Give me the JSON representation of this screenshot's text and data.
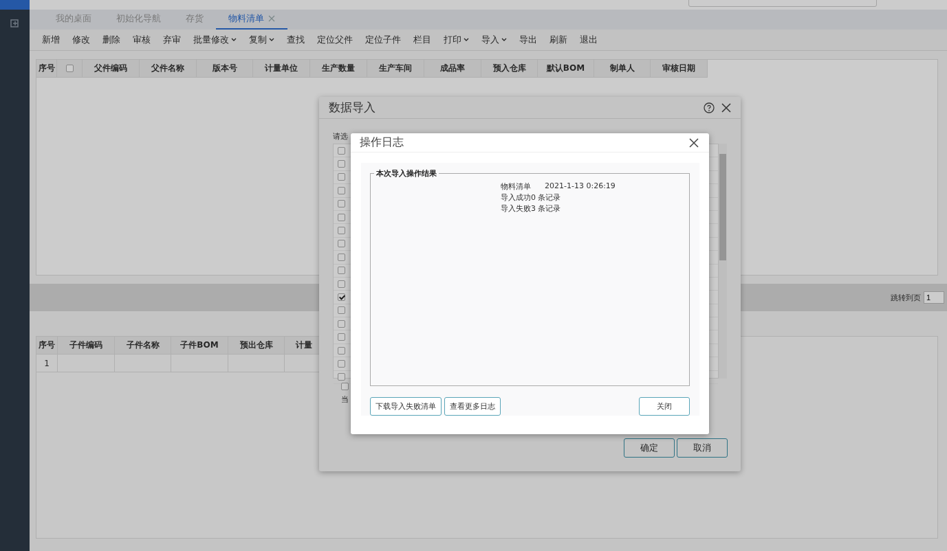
{
  "tabs": [
    {
      "label": "我的桌面",
      "selected": false,
      "closable": false
    },
    {
      "label": "初始化导航",
      "selected": false,
      "closable": false
    },
    {
      "label": "存货",
      "selected": false,
      "closable": false
    },
    {
      "label": "物料清单",
      "selected": true,
      "closable": true
    }
  ],
  "toolbar": [
    {
      "label": "新增",
      "dropdown": false
    },
    {
      "label": "修改",
      "dropdown": false
    },
    {
      "label": "删除",
      "dropdown": false
    },
    {
      "label": "审核",
      "dropdown": false
    },
    {
      "label": "弃审",
      "dropdown": false
    },
    {
      "label": "批量修改",
      "dropdown": true
    },
    {
      "label": "复制",
      "dropdown": true
    },
    {
      "label": "查找",
      "dropdown": false
    },
    {
      "label": "定位父件",
      "dropdown": false
    },
    {
      "label": "定位子件",
      "dropdown": false
    },
    {
      "label": "栏目",
      "dropdown": false
    },
    {
      "label": "打印",
      "dropdown": true
    },
    {
      "label": "导入",
      "dropdown": true
    },
    {
      "label": "导出",
      "dropdown": false
    },
    {
      "label": "刷新",
      "dropdown": false
    },
    {
      "label": "退出",
      "dropdown": false
    }
  ],
  "bom_table": {
    "index_column": "序号",
    "select_all_checked": false,
    "columns": [
      "父件编码",
      "父件名称",
      "版本号",
      "计量单位",
      "生产数量",
      "生产车间",
      "成品率",
      "预入仓库",
      "默认BOM",
      "制单人",
      "审核日期"
    ]
  },
  "pager": {
    "jump_label": "跳转到页",
    "page": "1"
  },
  "component_table": {
    "columns": [
      "序号",
      "子件编码",
      "子件名称",
      "子件BOM",
      "预出仓库",
      "计量"
    ],
    "rows": [
      [
        "1",
        "",
        "",
        "",
        "",
        ""
      ]
    ]
  },
  "import_dialog": {
    "title": "数据导入",
    "prompt": "请选",
    "items": [
      {
        "checked": false
      },
      {
        "checked": false
      },
      {
        "checked": false
      },
      {
        "checked": false
      },
      {
        "checked": false
      },
      {
        "checked": false
      },
      {
        "checked": false
      },
      {
        "checked": false
      },
      {
        "checked": false
      },
      {
        "checked": false
      },
      {
        "checked": false
      },
      {
        "checked": true
      },
      {
        "checked": false
      },
      {
        "checked": false
      },
      {
        "checked": false
      },
      {
        "checked": false
      },
      {
        "checked": false
      },
      {
        "checked": false
      }
    ],
    "footer_checked": false,
    "footer_text": "当",
    "buttons": [
      "确定",
      "取消"
    ]
  },
  "log_dialog": {
    "title": "操作日志",
    "group_title": "本次导入操作结果",
    "lines": [
      [
        "物料清单",
        "2021-1-13 0:26:19"
      ],
      [
        "导入成功0 条记录"
      ],
      [
        "导入失败3 条记录"
      ]
    ],
    "buttons": [
      {
        "label": "下载导入失败清单",
        "kind": "left"
      },
      {
        "label": "查看更多日志",
        "kind": "left"
      },
      {
        "label": "关闭",
        "kind": "right"
      }
    ]
  }
}
